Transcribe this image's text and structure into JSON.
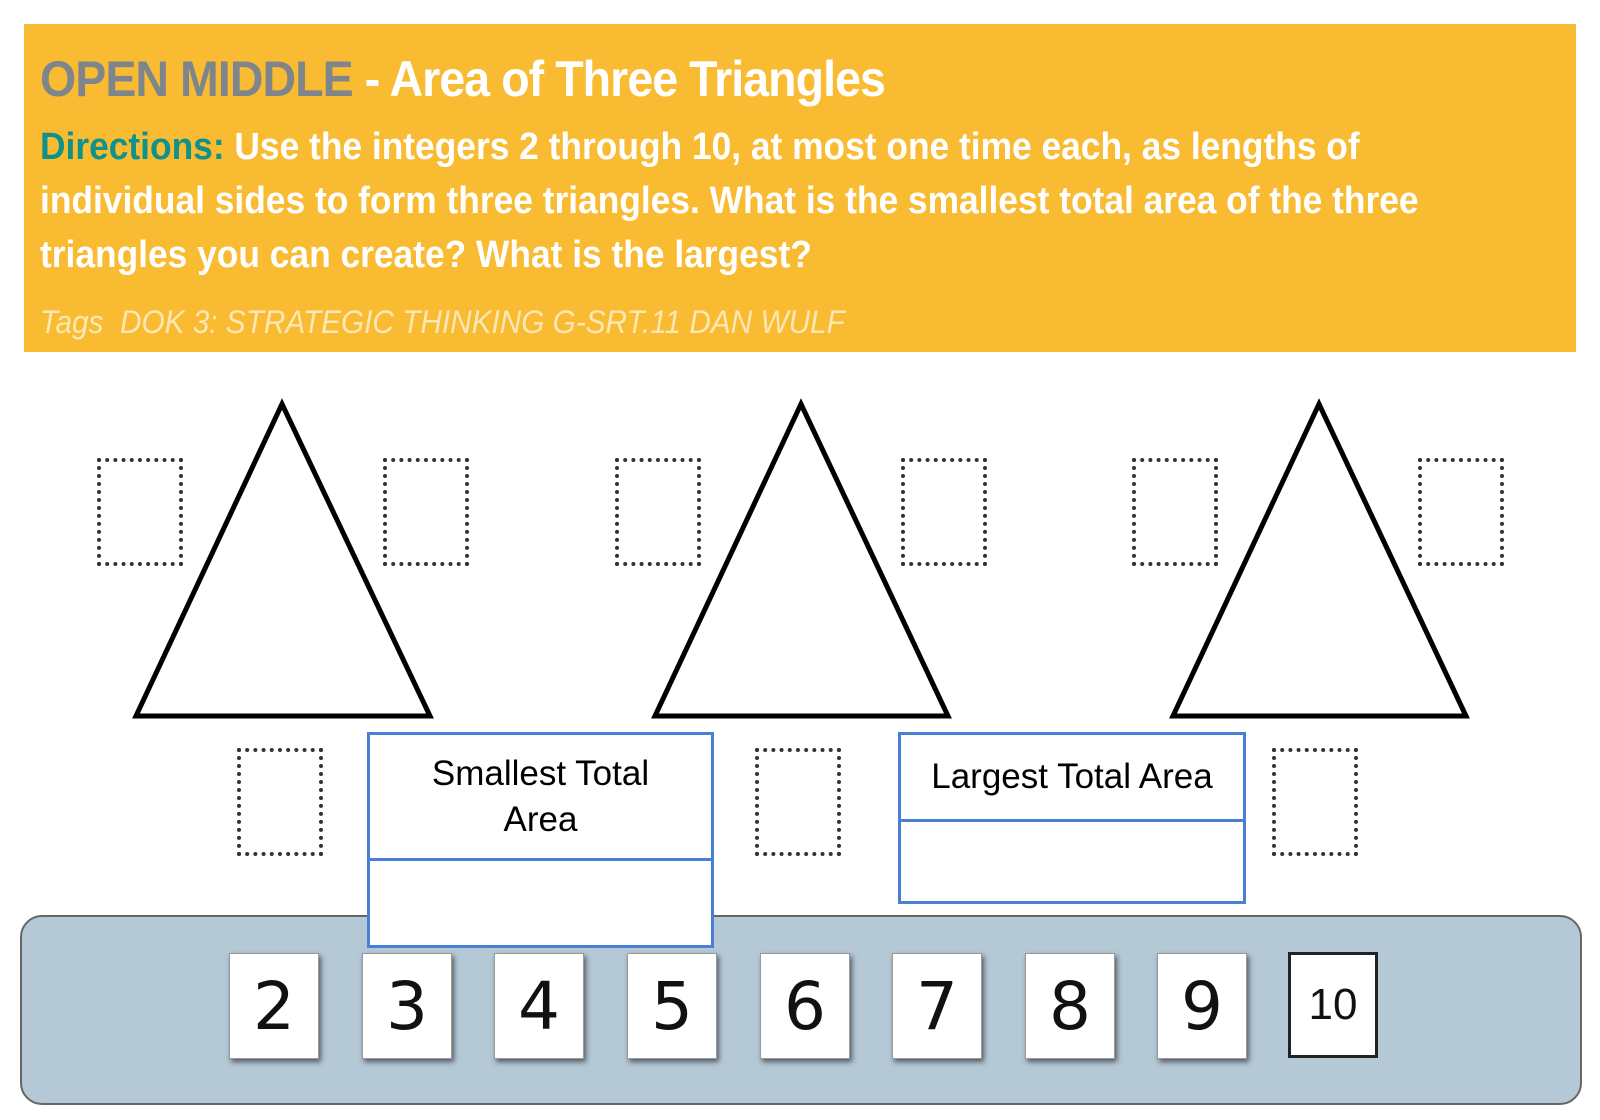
{
  "header": {
    "brand": "OPEN MIDDLE",
    "separator": " - ",
    "title": "Area of Three Triangles",
    "directions_label": "Directions:",
    "directions_text": " Use the integers 2 through 10, at most one time each, as lengths of individual sides to form three triangles. What is the smallest total area of the three triangles you can create? What is the largest?",
    "tags_label": "Tags",
    "tags": "DOK 3: STRATEGIC THINKING G-SRT.11 DAN WULF"
  },
  "colors": {
    "banner": "#f8bb32",
    "brand": "#7f868b",
    "directions_label": "#10918a",
    "tray": "#b4c8d6",
    "answer_border": "#4a7fd6"
  },
  "answers": {
    "smallest_label": "Smallest Total Area",
    "smallest_value": "",
    "largest_label": "Largest Total Area",
    "largest_value": ""
  },
  "number_tiles": [
    "2",
    "3",
    "4",
    "5",
    "6",
    "7",
    "8",
    "9",
    "10"
  ]
}
